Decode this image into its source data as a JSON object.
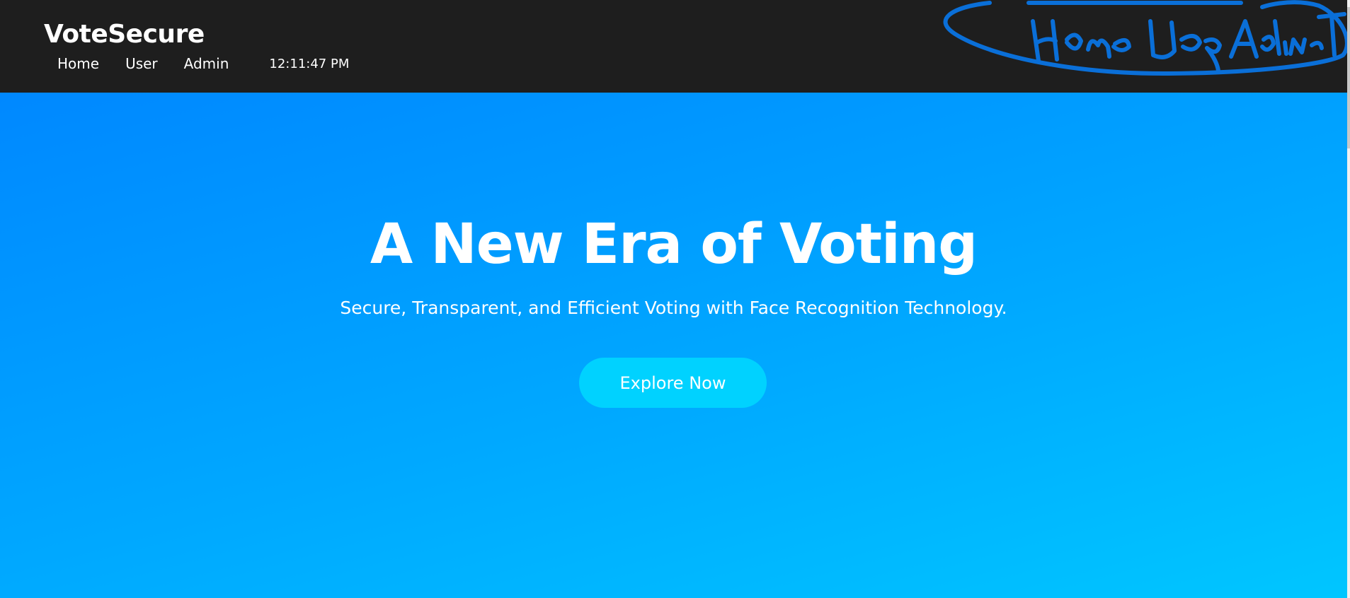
{
  "brand": "VoteSecure",
  "nav": {
    "items": [
      {
        "label": "Home"
      },
      {
        "label": "User"
      },
      {
        "label": "Admin"
      }
    ],
    "clock": "12:11:47 PM"
  },
  "annotation": {
    "description": "hand-drawn blue sketch",
    "color": "#0a6fd8"
  },
  "hero": {
    "title": "A New Era of Voting",
    "subtitle": "Secure, Transparent, and Efficient Voting with Face Recognition Technology.",
    "cta_label": "Explore Now"
  },
  "colors": {
    "nav_bg": "#1e1e1e",
    "hero_gradient_start": "#0088ff",
    "hero_gradient_end": "#00c6ff",
    "cta_bg": "#00d2ff"
  }
}
